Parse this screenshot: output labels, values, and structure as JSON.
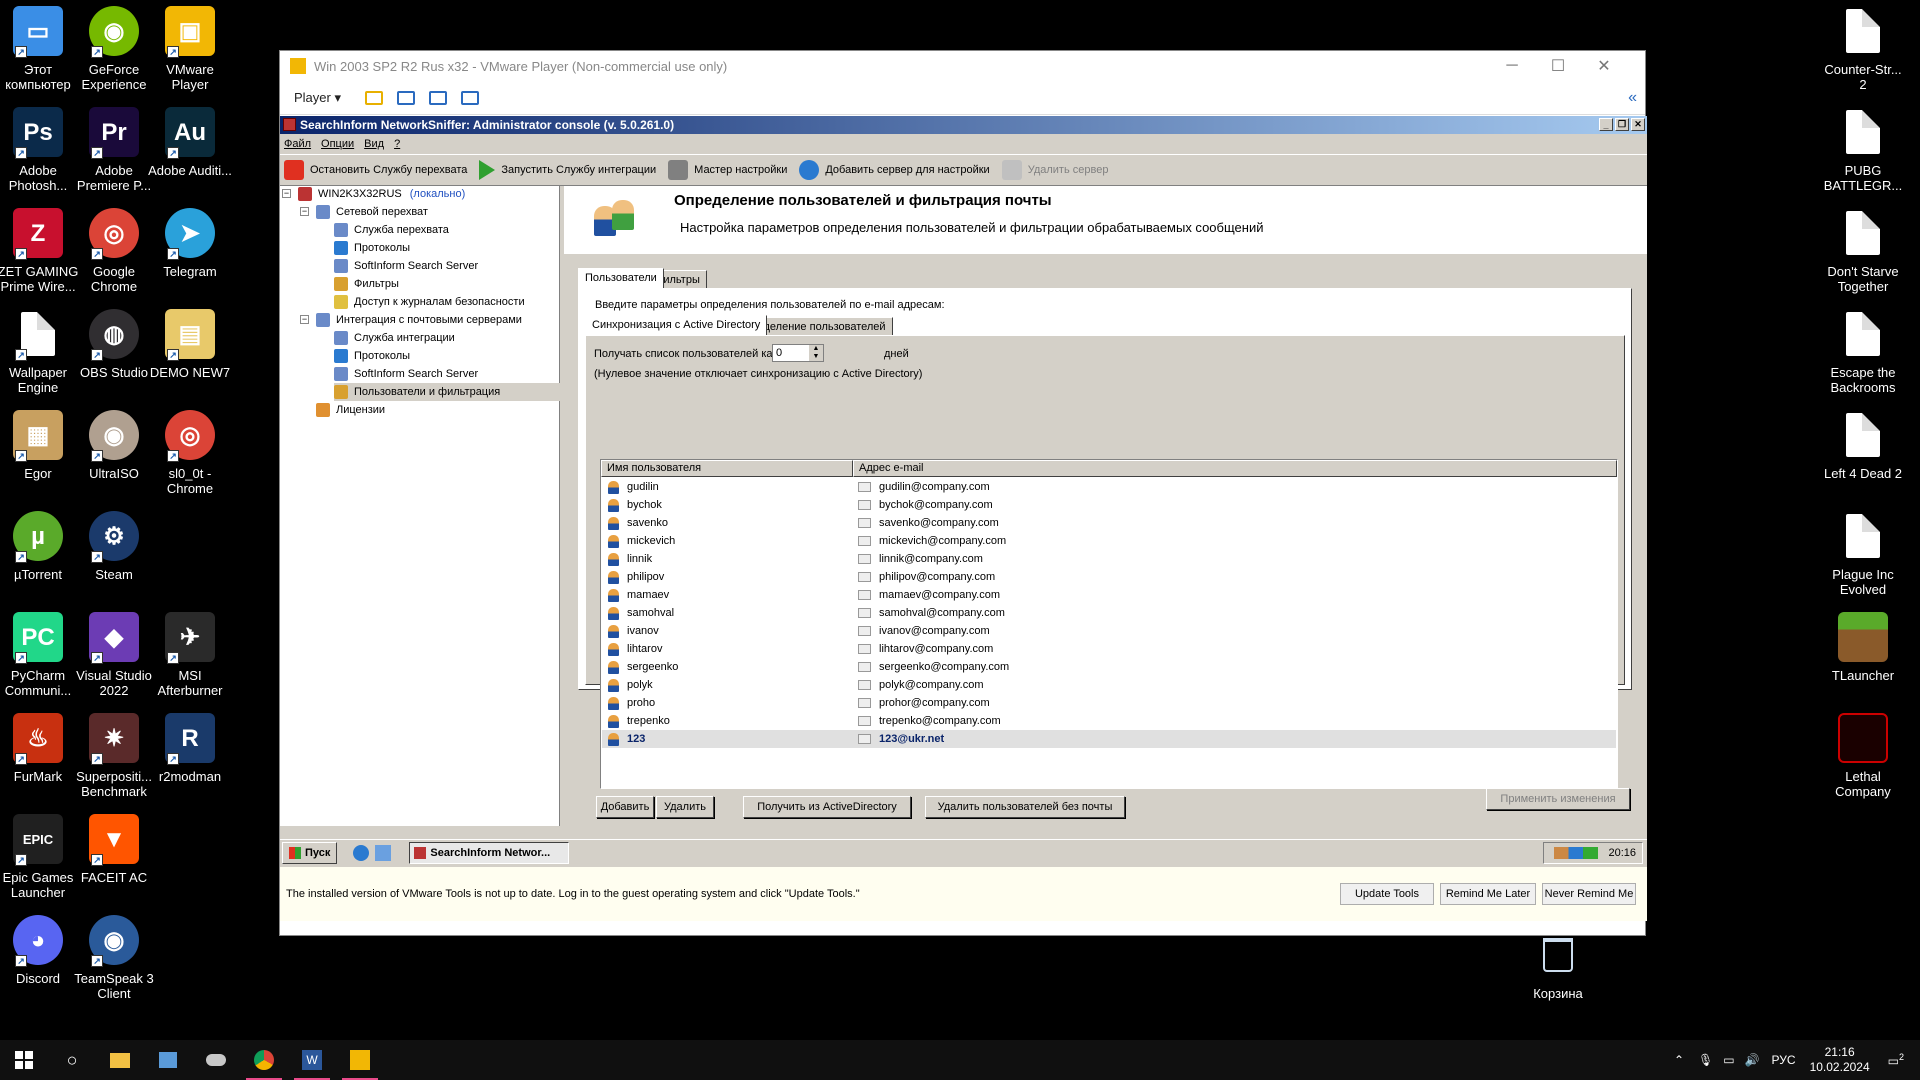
{
  "desktop": {
    "left_icons": [
      {
        "label": "Этот компьютер",
        "icon": "computer-icon",
        "color": "#3a8ee6",
        "glyph": "▭"
      },
      {
        "label": "GeForce Experience",
        "icon": "nvidia-icon",
        "color": "#76b900",
        "glyph": "◉"
      },
      {
        "label": "VMware Player",
        "icon": "vmware-icon",
        "color": "#f2b705",
        "glyph": "▣"
      },
      {
        "label": "Adobe Photosh...",
        "icon": "photoshop-icon",
        "color": "#0b2a4a",
        "glyph": "Ps"
      },
      {
        "label": "Adobe Premiere P...",
        "icon": "premiere-icon",
        "color": "#1a0a3a",
        "glyph": "Pr"
      },
      {
        "label": "Adobe Auditi...",
        "icon": "audition-icon",
        "color": "#0a2a3a",
        "glyph": "Au"
      },
      {
        "label": "ZET GAMING Prime Wire...",
        "icon": "zet-gaming-icon",
        "color": "#c8102e",
        "glyph": "Z"
      },
      {
        "label": "Google Chrome",
        "icon": "chrome-icon",
        "color": "#db4437",
        "glyph": "◎"
      },
      {
        "label": "Telegram",
        "icon": "telegram-icon",
        "color": "#2aa1da",
        "glyph": "➤"
      },
      {
        "label": "Wallpaper Engine",
        "icon": "wallpaper-engine-icon",
        "color": "#ffffff",
        "glyph": ""
      },
      {
        "label": "OBS Studio",
        "icon": "obs-icon",
        "color": "#302e31",
        "glyph": "◍"
      },
      {
        "label": "DEMO NEW7",
        "icon": "folder-icon",
        "color": "#e8c96a",
        "glyph": "▤"
      },
      {
        "label": "Egor",
        "icon": "folder-image-icon",
        "color": "#c8a060",
        "glyph": "▦"
      },
      {
        "label": "UltraISO",
        "icon": "ultraiso-icon",
        "color": "#b0a090",
        "glyph": "◉"
      },
      {
        "label": "sl0_0t - Chrome",
        "icon": "chrome-profile-icon",
        "color": "#db4437",
        "glyph": "◎"
      },
      {
        "label": "µTorrent",
        "icon": "utorrent-icon",
        "color": "#5aaa2a",
        "glyph": "µ"
      },
      {
        "label": "Steam",
        "icon": "steam-icon",
        "color": "#1b3a6b",
        "glyph": "⚙"
      },
      {
        "label": "",
        "icon": "empty",
        "color": "#000000",
        "glyph": ""
      },
      {
        "label": "PyCharm Communi...",
        "icon": "pycharm-icon",
        "color": "#21d789",
        "glyph": "PC"
      },
      {
        "label": "Visual Studio 2022",
        "icon": "visual-studio-icon",
        "color": "#6c3cb4",
        "glyph": "◆"
      },
      {
        "label": "MSI Afterburner",
        "icon": "msi-afterburner-icon",
        "color": "#2a2a2a",
        "glyph": "✈"
      },
      {
        "label": "FurMark",
        "icon": "furmark-icon",
        "color": "#c83010",
        "glyph": "♨"
      },
      {
        "label": "Superpositi... Benchmark",
        "icon": "superposition-icon",
        "color": "#5a2a2a",
        "glyph": "✷"
      },
      {
        "label": "r2modman",
        "icon": "r2modman-icon",
        "color": "#1a3a6a",
        "glyph": "R"
      },
      {
        "label": "Epic Games Launcher",
        "icon": "epic-games-icon",
        "color": "#202020",
        "glyph": "EPIC"
      },
      {
        "label": "FACEIT AC",
        "icon": "faceit-icon",
        "color": "#ff5500",
        "glyph": "▼"
      },
      {
        "label": "",
        "icon": "empty",
        "color": "#000000",
        "glyph": ""
      },
      {
        "label": "Discord",
        "icon": "discord-icon",
        "color": "#5865f2",
        "glyph": "◕"
      },
      {
        "label": "TeamSpeak 3 Client",
        "icon": "teamspeak-icon",
        "color": "#2a5a9a",
        "glyph": "◉"
      }
    ],
    "right_icons": [
      {
        "label": "Counter-Str... 2",
        "icon": "document-icon"
      },
      {
        "label": "PUBG BATTLEGR...",
        "icon": "document-icon"
      },
      {
        "label": "Don't Starve Together",
        "icon": "document-icon"
      },
      {
        "label": "Escape the Backrooms",
        "icon": "document-icon"
      },
      {
        "label": "Left 4 Dead 2",
        "icon": "document-icon"
      },
      {
        "label": "Plague Inc Evolved",
        "icon": "document-icon"
      },
      {
        "label": "TLauncher",
        "icon": "tlauncher-icon"
      },
      {
        "label": "Lethal Company",
        "icon": "lethal-company-icon"
      }
    ],
    "recycle_bin": "Корзина"
  },
  "vmware": {
    "title": "Win 2003 SP2 R2 Rus x32 - VMware Player (Non-commercial use only)",
    "player_menu": "Player",
    "notification": "The installed version of VMware Tools is not up to date. Log in to the guest operating system and click \"Update Tools.\"",
    "buttons": {
      "update": "Update Tools",
      "remind": "Remind Me Later",
      "never": "Never Remind Me"
    }
  },
  "app": {
    "title": "SearchInform NetworkSniffer: Administrator console (v. 5.0.261.0)",
    "menu": [
      "Файл",
      "Опции",
      "Вид",
      "?"
    ],
    "toolbar": [
      {
        "label": "Остановить Службу перехвата",
        "color": "#e03020",
        "disabled": false
      },
      {
        "label": "Запустить Службу интеграции",
        "color": "#30a030",
        "disabled": false
      },
      {
        "label": "Мастер настройки",
        "color": "#808080",
        "disabled": false
      },
      {
        "label": "Добавить сервер для настройки",
        "color": "#2a7ad0",
        "disabled": false
      },
      {
        "label": "Удалить сервер",
        "color": "#c0c0c0",
        "disabled": true
      }
    ],
    "tree": {
      "root": "WIN2K3X32RUS",
      "root_tag": "(локально)",
      "items": [
        {
          "label": "Сетевой перехват",
          "level": 1
        },
        {
          "label": "Служба перехвата",
          "level": 2
        },
        {
          "label": "Протоколы",
          "level": 2
        },
        {
          "label": "SoftInform Search Server",
          "level": 2
        },
        {
          "label": "Фильтры",
          "level": 2
        },
        {
          "label": "Доступ к журналам безопасности",
          "level": 2
        },
        {
          "label": "Интеграция с почтовыми серверами",
          "level": 1
        },
        {
          "label": "Служба интеграции",
          "level": 2
        },
        {
          "label": "Протоколы",
          "level": 2
        },
        {
          "label": "SoftInform Search Server",
          "level": 2
        },
        {
          "label": "Пользователи и фильтрация",
          "level": 2
        },
        {
          "label": "Лицензии",
          "level": 1
        }
      ]
    },
    "header": {
      "title": "Определение пользователей и фильтрация почты",
      "subtitle": "Настройка параметров определения пользователей и фильтрации обрабатываемых сообщений"
    },
    "tabs": [
      "Пользователи",
      "Фильтры"
    ],
    "intro": "Введите параметры определения пользователей по e-mail адресам:",
    "subtabs": [
      "Синхронизация с Active Directory",
      "Определение пользователей"
    ],
    "sync_label": "Получать список пользователей каждые",
    "sync_value": "0",
    "sync_unit": "дней",
    "sync_note": "(Нулевое значение отключает синхронизацию с Active Directory)",
    "columns": [
      "Имя пользователя",
      "Адрес e-mail"
    ],
    "users": [
      {
        "name": "gudilin",
        "email": "gudilin@company.com"
      },
      {
        "name": "bychok",
        "email": "bychok@company.com"
      },
      {
        "name": "savenko",
        "email": "savenko@company.com"
      },
      {
        "name": "mickevich",
        "email": "mickevich@company.com"
      },
      {
        "name": "linnik",
        "email": "linnik@company.com"
      },
      {
        "name": "philipov",
        "email": "philipov@company.com"
      },
      {
        "name": "mamaev",
        "email": "mamaev@company.com"
      },
      {
        "name": "samohval",
        "email": "samohval@company.com"
      },
      {
        "name": "ivanov",
        "email": "ivanov@company.com"
      },
      {
        "name": "lihtarov",
        "email": "lihtarov@company.com"
      },
      {
        "name": "sergeenko",
        "email": "sergeenko@company.com"
      },
      {
        "name": "polyk",
        "email": "polyk@company.com"
      },
      {
        "name": "proho",
        "email": "prohor@company.com"
      },
      {
        "name": "trepenko",
        "email": "trepenko@company.com"
      },
      {
        "name": "123",
        "email": "123@ukr.net",
        "selected": true
      }
    ],
    "buttons": {
      "add": "Добавить",
      "delete": "Удалить",
      "get_ad": "Получить из ActiveDirectory",
      "delete_no_mail": "Удалить пользователей без почты",
      "apply": "Применить изменения"
    }
  },
  "guest_taskbar": {
    "start": "Пуск",
    "task": "SearchInform Networ...",
    "time": "20:16"
  },
  "taskbar": {
    "lang": "РУС",
    "time": "21:16",
    "date": "10.02.2024",
    "notifications": "2"
  }
}
